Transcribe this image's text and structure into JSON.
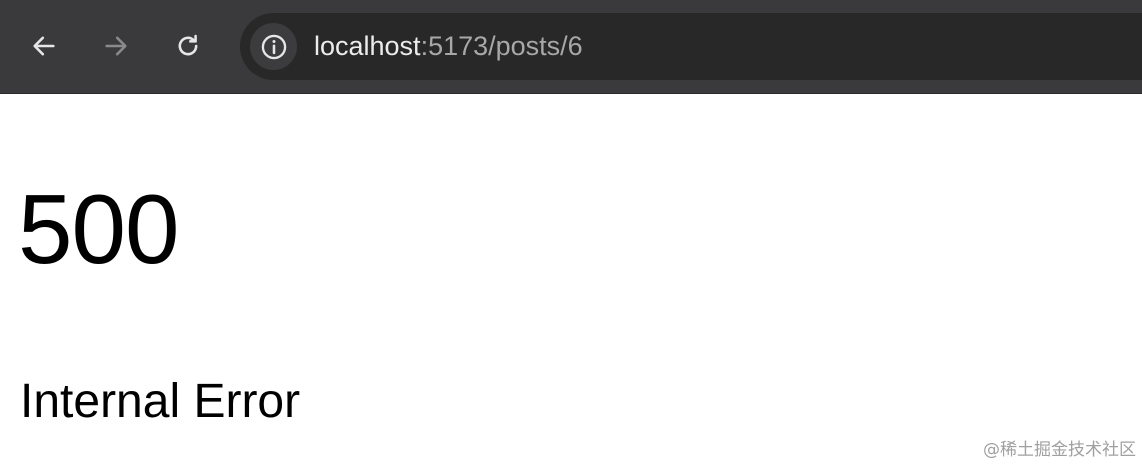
{
  "browser": {
    "toolbar_color": "#3a3a3c",
    "omnibox_color": "#282828",
    "nav": {
      "back_icon": "arrow-left-icon",
      "forward_icon": "arrow-right-icon",
      "reload_icon": "reload-icon",
      "forward_enabled": false
    },
    "site_info_icon": "info-circle-icon",
    "url": {
      "host": "localhost",
      "path": ":5173/posts/6"
    }
  },
  "page": {
    "status_code": "500",
    "message": "Internal Error"
  },
  "watermark": {
    "text": "@稀土掘金技术社区"
  }
}
